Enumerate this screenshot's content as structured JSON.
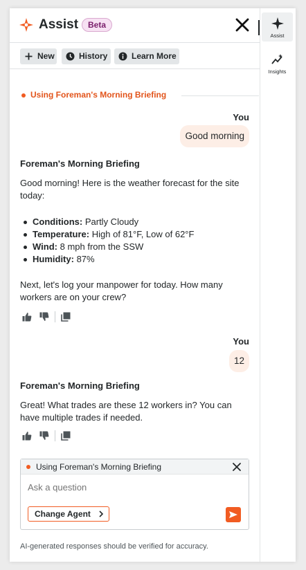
{
  "header": {
    "title": "Assist",
    "badge": "Beta"
  },
  "toolbar": {
    "new_label": "New",
    "history_label": "History",
    "learn_more_label": "Learn More"
  },
  "agent_indicator": {
    "text": "Using Foreman's Morning Briefing"
  },
  "messages": {
    "user1": {
      "sender": "You",
      "text": "Good morning"
    },
    "bot1": {
      "title": "Foreman's Morning Briefing",
      "intro": "Good morning! Here is the weather forecast for the site today:",
      "bullets": [
        {
          "label": "Conditions:",
          "value": "Partly Cloudy"
        },
        {
          "label": "Temperature:",
          "value": "High of 81°F, Low of 62°F"
        },
        {
          "label": "Wind:",
          "value": "8 mph from the SSW"
        },
        {
          "label": "Humidity:",
          "value": "87%"
        }
      ],
      "outro": "Next, let's log your manpower for today. How many workers are on your crew?"
    },
    "user2": {
      "sender": "You",
      "text": "12"
    },
    "bot2": {
      "title": "Foreman's Morning Briefing",
      "text": "Great! What trades are these 12 workers in? You can have multiple trades if needed."
    }
  },
  "composer": {
    "agent_text": "Using Foreman's Morning Briefing",
    "placeholder": "Ask a question",
    "change_agent_label": "Change Agent"
  },
  "disclaimer": "AI-generated responses should be verified for accuracy.",
  "rail": {
    "assist_label": "Assist",
    "insights_label": "Insights"
  },
  "colors": {
    "accent": "#f15c22",
    "bubble": "#fdeee6",
    "beta_bg": "#f7e1f3"
  },
  "icons": [
    "procore-logo-icon",
    "close-icon",
    "plus-icon",
    "clock-icon",
    "info-icon",
    "thumbs-up-icon",
    "thumbs-down-icon",
    "copy-icon",
    "chevron-right-icon",
    "send-icon",
    "sparkle-icon",
    "insights-icon"
  ]
}
